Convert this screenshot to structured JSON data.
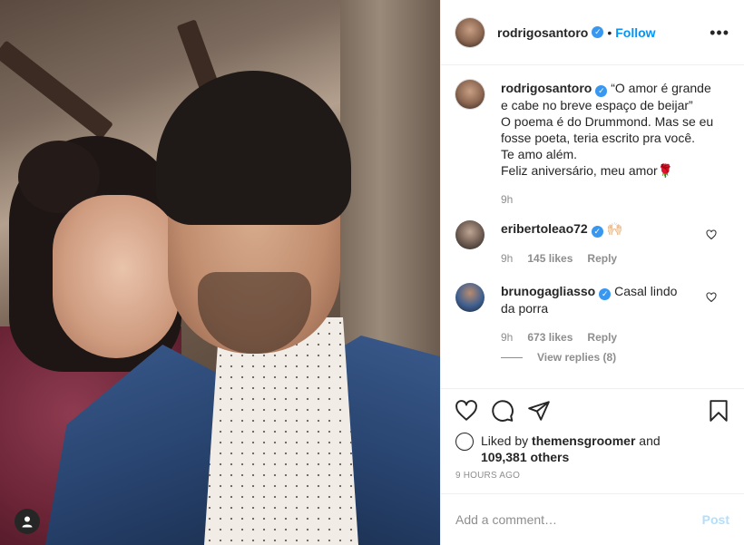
{
  "post": {
    "author": "rodrigosantoro",
    "follow_label": "Follow",
    "more_label": "•••",
    "caption": {
      "username": "rodrigosantoro",
      "lines": [
        "“O amor é grande",
        "e cabe no breve espaço de beijar”",
        "O poema é do Drummond. Mas se eu",
        "fosse poeta, teria escrito pra você.",
        "Te amo além.",
        "Feliz aniversário, meu amor🌹"
      ],
      "time": "9h"
    },
    "comments": [
      {
        "username": "eribertoleao72",
        "text": "🙌🏻",
        "time": "9h",
        "likes": "145 likes",
        "reply": "Reply"
      },
      {
        "username": "brunogagliasso",
        "text_line1": "Casal lindo",
        "text_line2": "da porra",
        "time": "9h",
        "likes": "673 likes",
        "reply": "Reply",
        "view_replies": "View replies (8)"
      }
    ],
    "liked_by": {
      "prefix": "Liked by",
      "user": "themensgroomer",
      "and": "and",
      "others": "109,381 others"
    },
    "timestamp": "9 HOURS AGO",
    "add_comment_placeholder": "Add a comment…",
    "post_label": "Post"
  },
  "colors": {
    "link_blue": "#0095f6",
    "verified_blue": "#3897f0",
    "post_disabled": "#b2dffc",
    "muted": "#8e8e8e"
  },
  "icons": [
    "heart-icon",
    "comment-icon",
    "share-icon",
    "bookmark-icon",
    "verified-badge-icon",
    "more-options-icon",
    "user-tag-icon"
  ]
}
